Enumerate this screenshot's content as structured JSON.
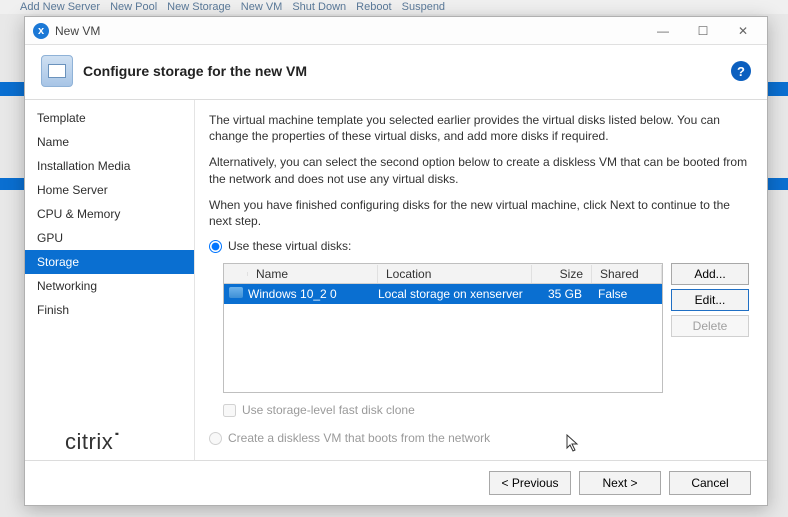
{
  "window": {
    "title": "New VM",
    "heading": "Configure storage for the new VM"
  },
  "bg_toolbar": {
    "items": [
      "Add New Server",
      "New Pool",
      "New Storage",
      "New VM",
      "Shut Down",
      "Reboot",
      "Suspend"
    ]
  },
  "sidebar": {
    "items": [
      {
        "label": "Template"
      },
      {
        "label": "Name"
      },
      {
        "label": "Installation Media"
      },
      {
        "label": "Home Server"
      },
      {
        "label": "CPU & Memory"
      },
      {
        "label": "GPU"
      },
      {
        "label": "Storage",
        "selected": true
      },
      {
        "label": "Networking"
      },
      {
        "label": "Finish"
      }
    ]
  },
  "content": {
    "p1": "The virtual machine template you selected earlier provides the virtual disks listed below. You can change the properties of these virtual disks, and add more disks if required.",
    "p2": "Alternatively, you can select the second option below to create a diskless VM that can be booted from the network and does not use any virtual disks.",
    "p3": "When you have finished configuring disks for the new virtual machine, click Next to continue to the next step.",
    "radio_use_disks": "Use these virtual disks:",
    "chk_fastclone": "Use storage-level fast disk clone",
    "radio_diskless": "Create a diskless VM that boots from the network"
  },
  "table": {
    "headers": {
      "name": "Name",
      "location": "Location",
      "size": "Size",
      "shared": "Shared"
    },
    "rows": [
      {
        "name": "Windows 10_2 0",
        "location": "Local storage on xenserver",
        "size": "35 GB",
        "shared": "False",
        "selected": true
      }
    ]
  },
  "buttons": {
    "add": "Add...",
    "edit": "Edit...",
    "delete": "Delete",
    "prev": "< Previous",
    "next": "Next >",
    "cancel": "Cancel"
  },
  "brand": "citrix"
}
